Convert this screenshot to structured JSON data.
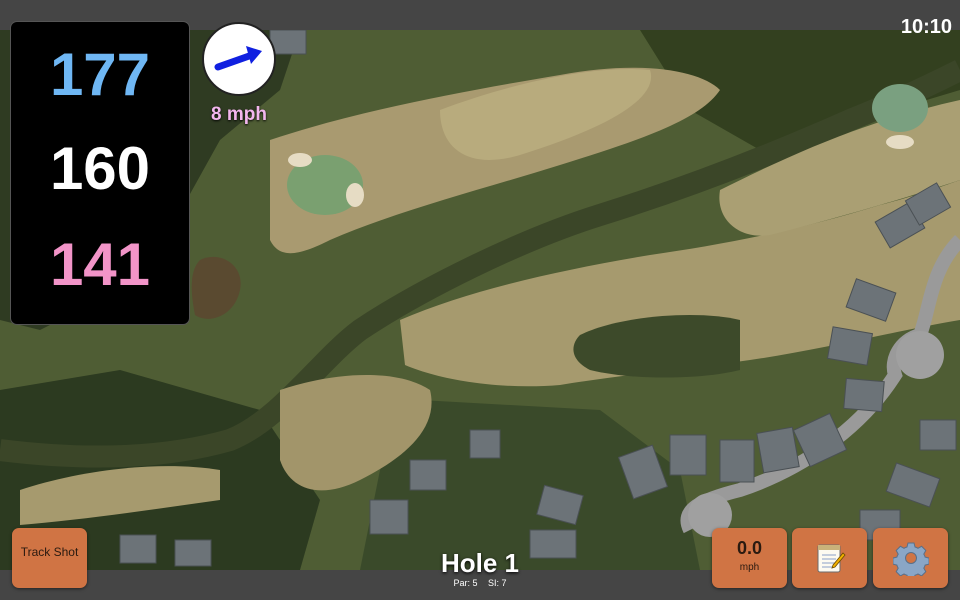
{
  "status": {
    "time": "10:10"
  },
  "distances": {
    "back": "177",
    "center": "160",
    "front": "141"
  },
  "wind": {
    "speed": "8 mph",
    "direction_icon": "arrow-icon"
  },
  "hole": {
    "title": "Hole 1",
    "par": "Par: 5",
    "si": "SI: 7"
  },
  "buttons": {
    "track_shot": "Track Shot",
    "speed_value": "0.0",
    "speed_unit": "mph",
    "notes_icon": "notepad-icon",
    "settings_icon": "gear-icon"
  },
  "colors": {
    "back_distance": "#6fb7f4",
    "center_distance": "#ffffff",
    "front_distance": "#f294c8",
    "wind_label": "#f3b6ee",
    "button_orange": "#d07444"
  }
}
